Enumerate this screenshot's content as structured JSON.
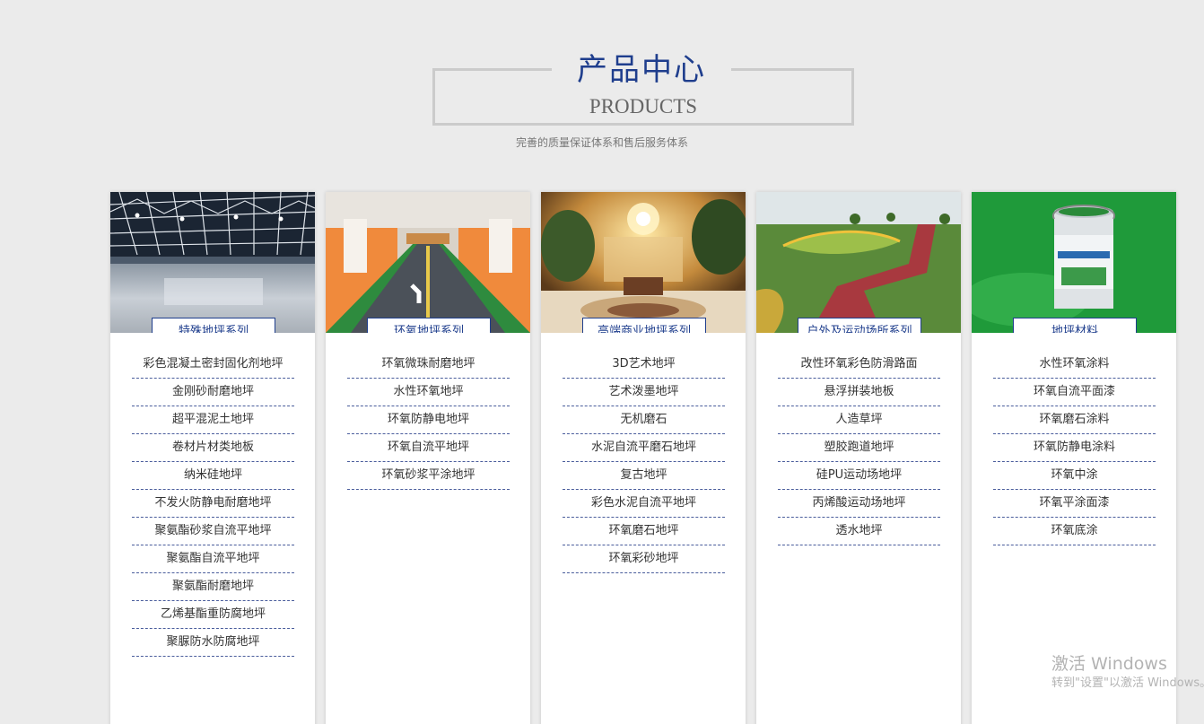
{
  "section": {
    "title_cn": "产品中心",
    "title_en": "PRODUCTS",
    "subtitle": "完善的质量保证体系和售后服务体系"
  },
  "cards": [
    {
      "label": "特殊地坪系列",
      "image": "warehouse-floor-photo",
      "items": [
        "彩色混凝土密封固化剂地坪",
        "金刚砂耐磨地坪",
        "超平混泥土地坪",
        "卷材片材类地板",
        "纳米硅地坪",
        "不发火防静电耐磨地坪",
        "聚氨酯砂浆自流平地坪",
        "聚氨酯自流平地坪",
        "聚氨酯耐磨地坪",
        "乙烯基酯重防腐地坪",
        "聚脲防水防腐地坪"
      ]
    },
    {
      "label": "环氧地坪系列",
      "image": "parking-garage-photo",
      "items": [
        "环氧微珠耐磨地坪",
        "水性环氧地坪",
        "环氧防静电地坪",
        "环氧自流平地坪",
        "环氧砂浆平涂地坪"
      ]
    },
    {
      "label": "高端商业地坪系列",
      "image": "hotel-lobby-photo",
      "items": [
        "3D艺术地坪",
        "艺术泼墨地坪",
        "无机磨石",
        "水泥自流平磨石地坪",
        "复古地坪",
        "彩色水泥自流平地坪",
        "环氧磨石地坪",
        "环氧彩砂地坪"
      ]
    },
    {
      "label": "户外及运动场所系列",
      "image": "red-path-photo",
      "items": [
        "改性环氧彩色防滑路面",
        "悬浮拼装地板",
        "人造草坪",
        "塑胶跑道地坪",
        "硅PU运动场地坪",
        "丙烯酸运动场地坪",
        "透水地坪"
      ]
    },
    {
      "label": "地坪材料",
      "image": "paint-bucket-photo",
      "items": [
        "水性环氧涂料",
        "环氧自流平面漆",
        "环氧磨石涂料",
        "环氧防静电涂料",
        "环氧中涂",
        "环氧平涂面漆",
        "环氧底涂"
      ]
    }
  ],
  "watermark": {
    "line1": "激活 Windows",
    "line2": "转到\"设置\"以激活 Windows。"
  },
  "colors": {
    "accent": "#1f3e8d",
    "background": "#ebebeb",
    "frame": "#cbcbcb"
  }
}
